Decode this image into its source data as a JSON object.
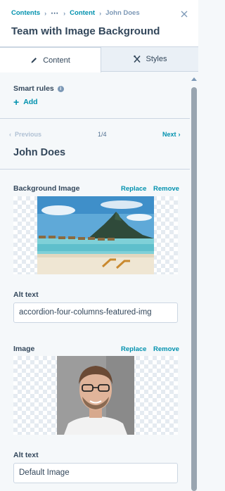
{
  "breadcrumb": {
    "root": "Contents",
    "middle": "Content",
    "current": "John Does"
  },
  "panel": {
    "title": "Team with Image Background"
  },
  "tabs": [
    {
      "label": "Content",
      "icon": "pencil-icon",
      "active": true
    },
    {
      "label": "Styles",
      "icon": "styles-icon",
      "active": false
    }
  ],
  "smart_rules": {
    "label": "Smart rules",
    "add_label": "Add"
  },
  "pager": {
    "prev_label": "Previous",
    "count": "1/4",
    "next_label": "Next"
  },
  "item": {
    "title": "John Does"
  },
  "background_image": {
    "label": "Background Image",
    "replace_label": "Replace",
    "remove_label": "Remove",
    "alt_label": "Alt text",
    "alt_value": "accordion-four-columns-featured-img"
  },
  "image": {
    "label": "Image",
    "replace_label": "Replace",
    "remove_label": "Remove",
    "alt_label": "Alt text",
    "alt_value": "Default Image"
  },
  "colors": {
    "accent": "#0091ae",
    "text": "#33475b",
    "border": "#cbd6e2",
    "panel_bg": "#f5f8fa"
  }
}
